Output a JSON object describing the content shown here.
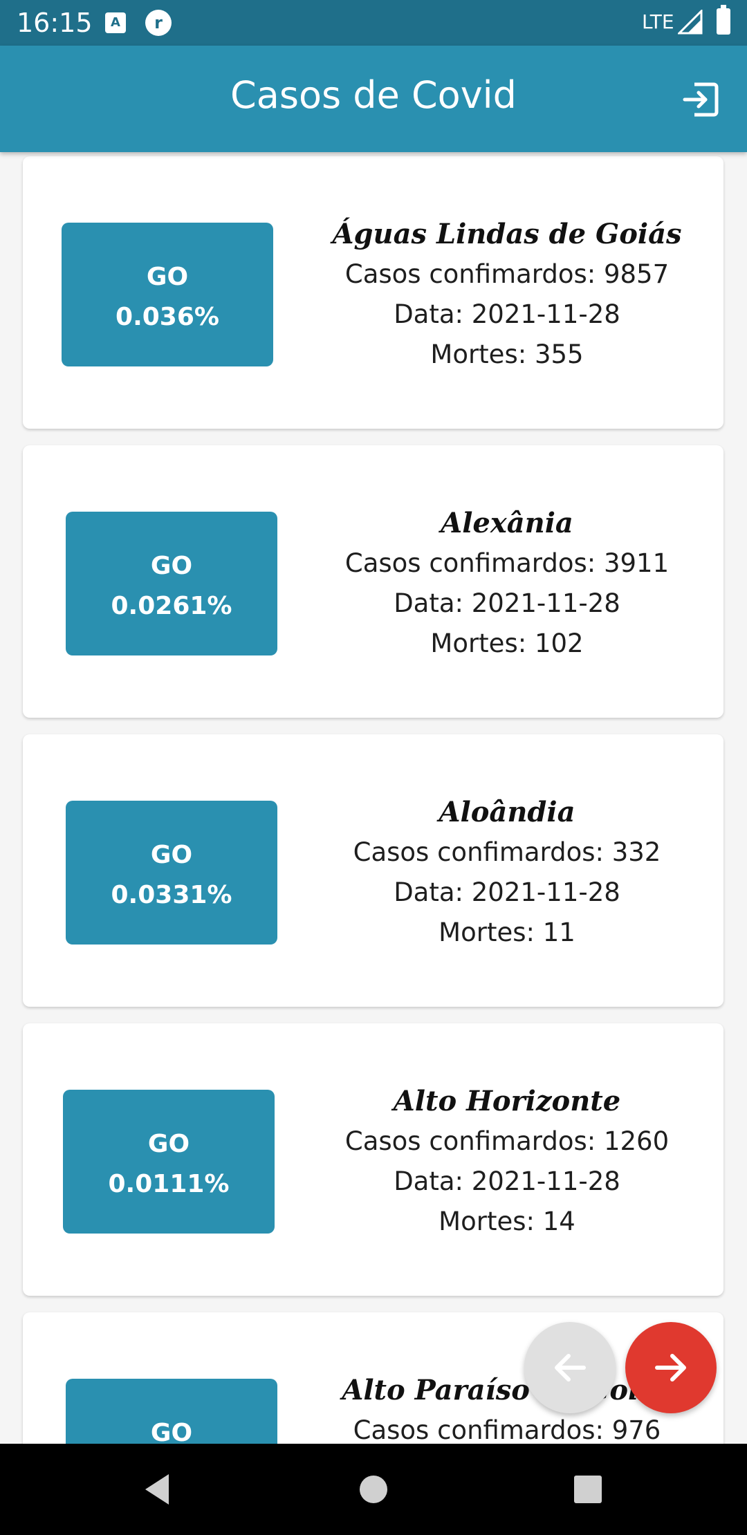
{
  "status_bar": {
    "time": "16:15",
    "icon_a": "A",
    "icon_r": "r",
    "network": "LTE"
  },
  "app_bar": {
    "title": "Casos de Covid",
    "logout_icon": "logout-icon"
  },
  "cases": [
    {
      "state": "GO",
      "percent": "0.036%",
      "city": "Águas Lindas de Goiás",
      "confirmed": "Casos confimardos: 9857",
      "date": "Data: 2021-11-28",
      "deaths": "Mortes: 355"
    },
    {
      "state": "GO",
      "percent": "0.0261%",
      "city": "Alexânia",
      "confirmed": "Casos confimardos: 3911",
      "date": "Data: 2021-11-28",
      "deaths": "Mortes: 102"
    },
    {
      "state": "GO",
      "percent": "0.0331%",
      "city": "Aloândia",
      "confirmed": "Casos confimardos: 332",
      "date": "Data: 2021-11-28",
      "deaths": "Mortes: 11"
    },
    {
      "state": "GO",
      "percent": "0.0111%",
      "city": "Alto Horizonte",
      "confirmed": "Casos confimardos: 1260",
      "date": "Data: 2021-11-28",
      "deaths": "Mortes: 14"
    },
    {
      "state": "GO",
      "percent": "",
      "city": "Alto Paraíso de Goiás",
      "confirmed": "Casos confimardos: 976",
      "date": "",
      "deaths": ""
    }
  ],
  "pagination": {
    "prev_icon": "arrow-left-icon",
    "next_icon": "arrow-right-icon"
  },
  "colors": {
    "status_bar": "#1f6f8a",
    "app_bar": "#2a90b0",
    "badge": "#2a90b0",
    "fab_next": "#e0392f",
    "fab_prev": "#e0e0e0"
  }
}
